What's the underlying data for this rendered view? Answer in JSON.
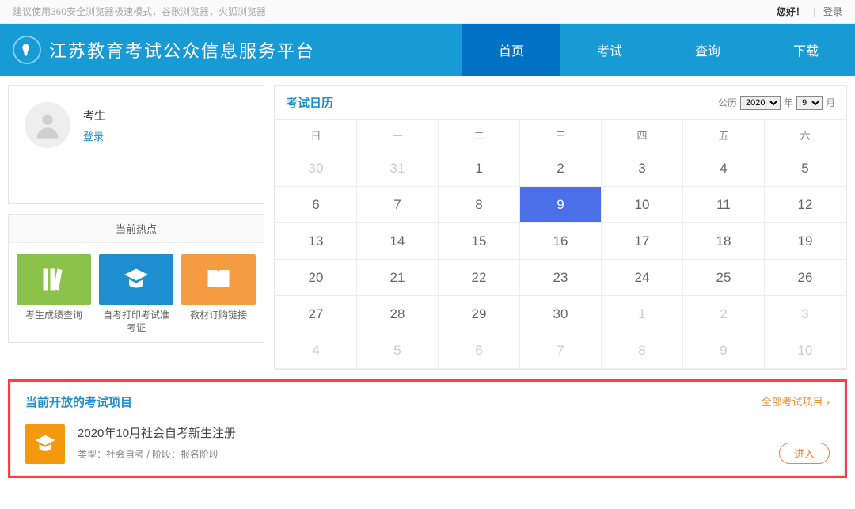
{
  "topbar": {
    "tip": "建议使用360安全浏览器极速模式，谷歌浏览器，火狐浏览器",
    "greet": "您好！",
    "login": "登录"
  },
  "header": {
    "title": "江苏教育考试公众信息服务平台",
    "nav": [
      "首页",
      "考试",
      "查询",
      "下载"
    ],
    "active": 0
  },
  "user": {
    "role": "考生",
    "login": "登录"
  },
  "hotspot": {
    "title": "当前热点",
    "items": [
      "考生成绩查询",
      "自考打印考试准考证",
      "教材订购链接"
    ]
  },
  "calendar": {
    "title": "考试日历",
    "era": "公历",
    "year_label": "年",
    "month_label": "月",
    "year": "2020",
    "month": "9",
    "weekdays": [
      "日",
      "一",
      "二",
      "三",
      "四",
      "五",
      "六"
    ],
    "weeks": [
      [
        {
          "d": 30,
          "o": true
        },
        {
          "d": 31,
          "o": true
        },
        {
          "d": 1
        },
        {
          "d": 2
        },
        {
          "d": 3
        },
        {
          "d": 4
        },
        {
          "d": 5
        }
      ],
      [
        {
          "d": 6
        },
        {
          "d": 7
        },
        {
          "d": 8
        },
        {
          "d": 9,
          "t": true
        },
        {
          "d": 10
        },
        {
          "d": 11
        },
        {
          "d": 12
        }
      ],
      [
        {
          "d": 13
        },
        {
          "d": 14
        },
        {
          "d": 15
        },
        {
          "d": 16
        },
        {
          "d": 17
        },
        {
          "d": 18
        },
        {
          "d": 19
        }
      ],
      [
        {
          "d": 20
        },
        {
          "d": 21
        },
        {
          "d": 22
        },
        {
          "d": 23
        },
        {
          "d": 24
        },
        {
          "d": 25
        },
        {
          "d": 26
        }
      ],
      [
        {
          "d": 27
        },
        {
          "d": 28
        },
        {
          "d": 29
        },
        {
          "d": 30
        },
        {
          "d": 1,
          "o": true
        },
        {
          "d": 2,
          "o": true
        },
        {
          "d": 3,
          "o": true
        }
      ],
      [
        {
          "d": 4,
          "o": true
        },
        {
          "d": 5,
          "o": true
        },
        {
          "d": 6,
          "o": true
        },
        {
          "d": 7,
          "o": true
        },
        {
          "d": 8,
          "o": true
        },
        {
          "d": 9,
          "o": true
        },
        {
          "d": 10,
          "o": true
        }
      ]
    ]
  },
  "open": {
    "title": "当前开放的考试项目",
    "all": "全部考试项目",
    "entry": {
      "name": "2020年10月社会自考新生注册",
      "meta": "类型：社会自考 / 阶段：报名阶段",
      "enter": "进入"
    }
  }
}
